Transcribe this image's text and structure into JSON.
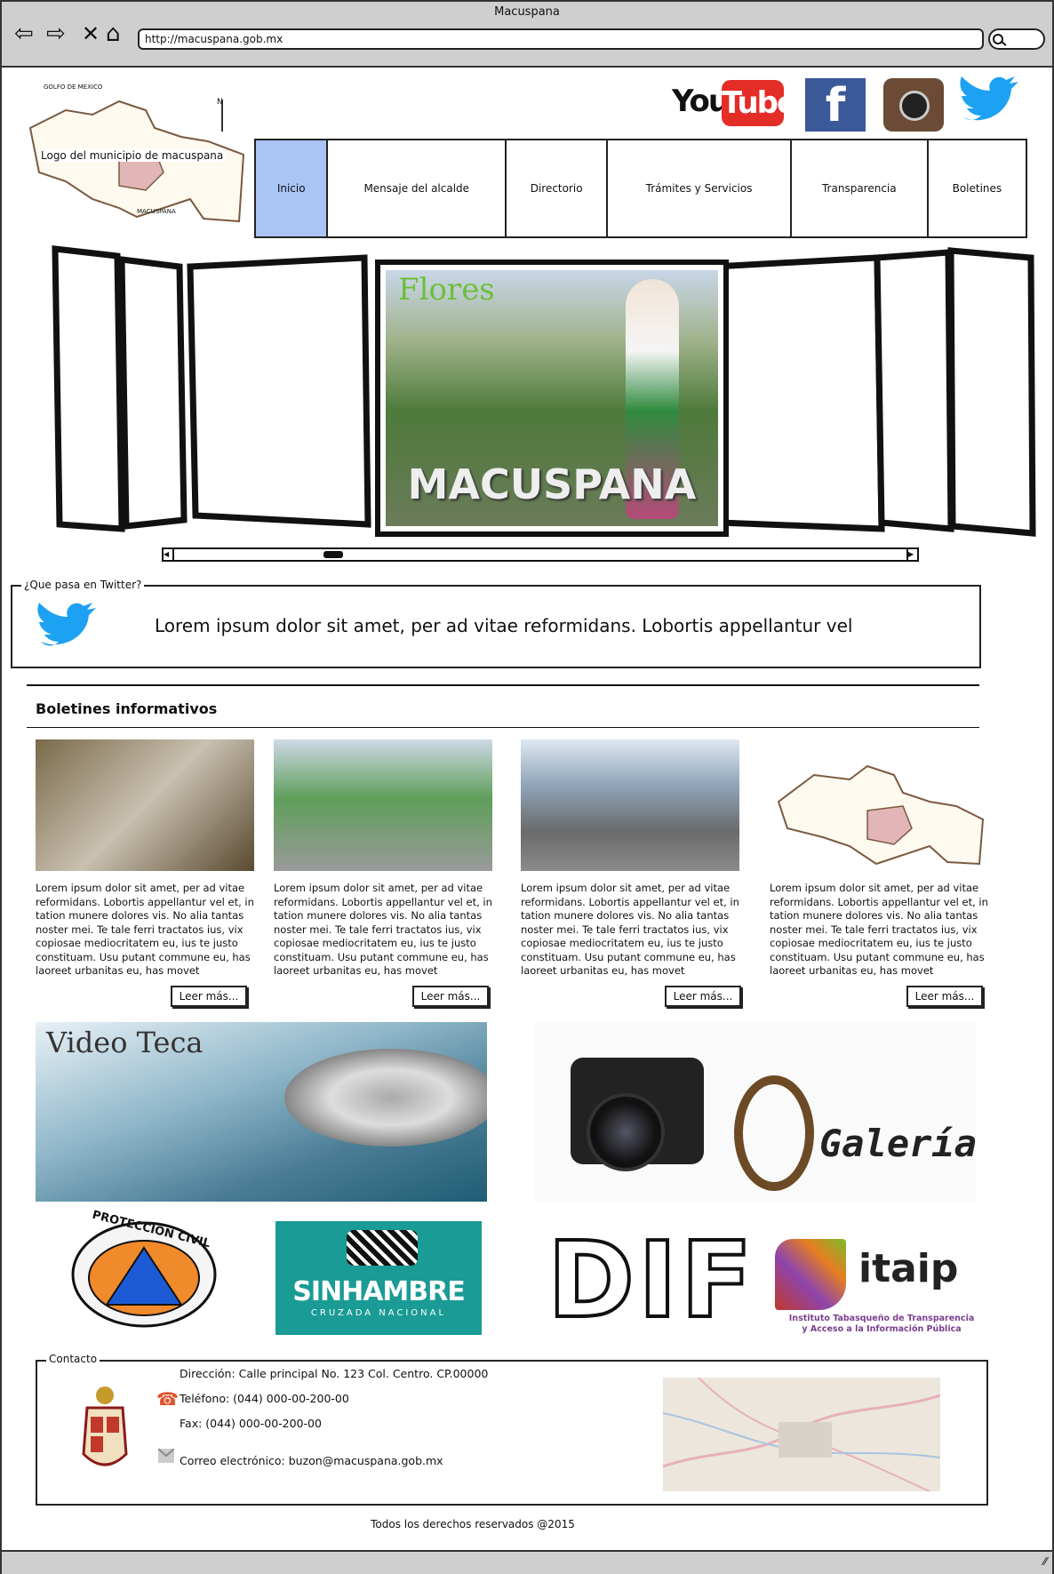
{
  "browser": {
    "title": "Macuspana",
    "url": "http://macuspana.gob.mx"
  },
  "header": {
    "logo_label": "Logo del municipio de macuspana",
    "map_labels": {
      "gulf": "GOLFO DE MEXICO",
      "town": "MACUSPANA",
      "north": "N"
    },
    "social": {
      "youtube_you": "You",
      "youtube_tube": "Tube",
      "facebook": "f"
    }
  },
  "menu": {
    "items": [
      "Inicio",
      "Mensaje del alcalde",
      "Directorio",
      "Trámites y Servicios",
      "Transparencia",
      "Boletines"
    ]
  },
  "carousel": {
    "photo_script": "Flores",
    "photo_caption": "MACUSPANA"
  },
  "twitter": {
    "legend": "¿Que pasa en Twitter?",
    "tweet": "Lorem ipsum dolor sit amet, per ad vitae reformidans. Lobortis appellantur vel"
  },
  "boletines": {
    "heading": "Boletines informativos",
    "items": [
      {
        "text": "Lorem ipsum dolor sit amet, per ad vitae reformidans. Lobortis appellantur vel et, in tation munere dolores vis. No alia tantas noster mei. Te tale ferri tractatos ius, vix copiosae mediocritatem eu, ius te justo constituam. Usu putant commune eu, has laoreet urbanitas eu, has movet",
        "button": "Leer más..."
      },
      {
        "text": "Lorem ipsum dolor sit amet, per ad vitae reformidans. Lobortis appellantur vel et, in tation munere dolores vis. No alia tantas noster mei. Te tale ferri tractatos ius, vix copiosae mediocritatem eu, ius te justo constituam. Usu putant commune eu, has laoreet urbanitas eu, has movet",
        "button": "Leer más..."
      },
      {
        "text": "Lorem ipsum dolor sit amet, per ad vitae reformidans. Lobortis appellantur vel et, in tation munere dolores vis. No alia tantas noster mei. Te tale ferri tractatos ius, vix copiosae mediocritatem eu, ius te justo constituam. Usu putant commune eu, has laoreet urbanitas eu, has movet",
        "button": "Leer más..."
      },
      {
        "text": "Lorem ipsum dolor sit amet, per ad vitae reformidans. Lobortis appellantur vel et, in tation munere dolores vis. No alia tantas noster mei. Te tale ferri tractatos ius, vix copiosae mediocritatem eu, ius te justo constituam. Usu putant commune eu, has laoreet urbanitas eu, has movet",
        "button": "Leer más..."
      }
    ]
  },
  "media": {
    "videoteca": "Video Teca",
    "galeria": "Galería"
  },
  "partners": {
    "proteccion": "PROTECCION CIVIL",
    "sinhambre": "SINHAMBRE",
    "sinhambre_sub": "CRUZADA NACIONAL",
    "dif": "DIF",
    "itaip": "itaip",
    "itaip_sub1": "Instituto Tabasqueño de Transparencia",
    "itaip_sub2": "y Acceso a la Información Pública"
  },
  "contact": {
    "legend": "Contacto",
    "address": "Dirección: Calle principal No. 123 Col. Centro. CP.00000",
    "phone": "Teléfono: (044) 000-00-200-00",
    "fax": "Fax: (044) 000-00-200-00",
    "email": "Correo electrónico: buzon@macuspana.gob.mx"
  },
  "footer": {
    "text": "Todos los derechos reservados @2015"
  },
  "colors": {
    "active_menu": "#a9c4f5",
    "youtube_red": "#e52d27",
    "facebook_blue": "#3b5998",
    "twitter_blue": "#1da1f2",
    "sinhambre_teal": "#1a9b95"
  }
}
